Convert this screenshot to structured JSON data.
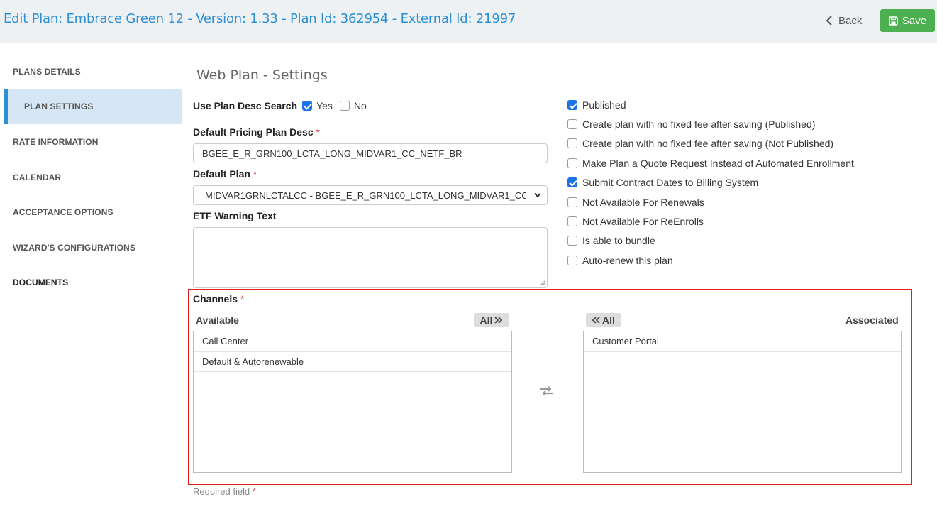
{
  "header": {
    "title": "Edit Plan: Embrace Green 12 - Version: 1.33 - Plan Id: 362954 - External Id: 21997",
    "back_label": "Back",
    "save_label": "Save"
  },
  "sidebar": {
    "items": [
      {
        "label": "PLANS DETAILS"
      },
      {
        "label": "PLAN SETTINGS",
        "active": true
      },
      {
        "label": "RATE INFORMATION"
      },
      {
        "label": "CALENDAR"
      },
      {
        "label": "ACCEPTANCE OPTIONS"
      },
      {
        "label": "WIZARD'S CONFIGURATIONS"
      },
      {
        "label": "DOCUMENTS"
      }
    ]
  },
  "main": {
    "section_title": "Web Plan - Settings",
    "use_plan_desc": {
      "label": "Use Plan Desc Search",
      "yes_label": "Yes",
      "no_label": "No",
      "yes_checked": true,
      "no_checked": false
    },
    "default_pricing": {
      "label": "Default Pricing Plan Desc",
      "required_mark": "*",
      "value": "BGEE_E_R_GRN100_LCTA_LONG_MIDVAR1_CC_NETF_BR"
    },
    "default_plan": {
      "label": "Default Plan",
      "required_mark": "*",
      "value": "MIDVAR1GRNLCTALCC - BGEE_E_R_GRN100_LCTA_LONG_MIDVAR1_CC"
    },
    "etf_warning": {
      "label": "ETF Warning Text",
      "value": ""
    },
    "options": [
      {
        "label": "Published",
        "checked": true
      },
      {
        "label": "Create plan with no fixed fee after saving (Published)",
        "checked": false
      },
      {
        "label": "Create plan with no fixed fee after saving (Not Published)",
        "checked": false
      },
      {
        "label": "Make Plan a Quote Request Instead of Automated Enrollment",
        "checked": false
      },
      {
        "label": "Submit Contract Dates to Billing System",
        "checked": true
      },
      {
        "label": "Not Available For Renewals",
        "checked": false
      },
      {
        "label": "Not Available For ReEnrolls",
        "checked": false
      },
      {
        "label": "Is able to bundle",
        "checked": false
      },
      {
        "label": "Auto-renew this plan",
        "checked": false
      }
    ],
    "channels": {
      "label": "Channels",
      "required_mark": "*",
      "available_label": "Available",
      "associated_label": "Associated",
      "move_all_right_label": "All",
      "move_all_left_label": "All",
      "available_items": [
        "Call Center",
        "Default & Autorenewable"
      ],
      "associated_items": [
        "Customer Portal"
      ]
    },
    "required_note": {
      "text": "Required field",
      "mark": "*"
    }
  },
  "colors": {
    "title_blue": "#2b8fd6",
    "save_green": "#4caf50",
    "checkbox_blue": "#1a73e8",
    "highlight_red": "#e02020",
    "sidebar_active_bg": "#d6e6f4"
  }
}
